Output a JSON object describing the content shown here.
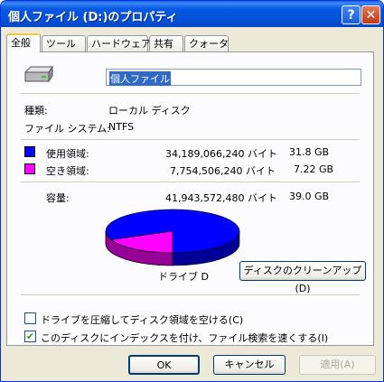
{
  "window": {
    "title": "個人ファイル (D:)のプロパティ",
    "help_glyph": "?",
    "close_glyph": "✕"
  },
  "tabs": [
    {
      "label": "全般",
      "active": true
    },
    {
      "label": "ツール"
    },
    {
      "label": "ハードウェア"
    },
    {
      "label": "共有"
    },
    {
      "label": "クォータ"
    }
  ],
  "general": {
    "drive_name": "個人ファイル",
    "type_label": "種類:",
    "type_value": "ローカル ディスク",
    "fs_label": "ファイル システム:",
    "fs_value": "NTFS",
    "used_label": "使用領域:",
    "used_bytes": "34,189,066,240 バイト",
    "used_gb": "31.8 GB",
    "free_label": "空き領域:",
    "free_bytes": "7,754,506,240 バイト",
    "free_gb": "7.22 GB",
    "capacity_label": "容量:",
    "capacity_bytes": "41,943,572,480 バイト",
    "capacity_gb": "39.0 GB",
    "drive_caption": "ドライブ D",
    "cleanup_button": "ディスクのクリーンアップ(D)",
    "compress_label": "ドライブを圧縮してディスク領域を空ける(C)",
    "compress_checked": false,
    "index_label": "このディスクにインデックスを付け、ファイル検索を速くする(I)",
    "index_checked": true
  },
  "colors": {
    "used": "#0000ff",
    "free": "#ff00ff"
  },
  "pie": {
    "used_fraction": 0.815,
    "free_fraction": 0.185
  },
  "buttons": {
    "ok": "OK",
    "cancel": "キャンセル",
    "apply": "適用(A)"
  },
  "icons": {
    "drive": "hard-drive-icon"
  }
}
